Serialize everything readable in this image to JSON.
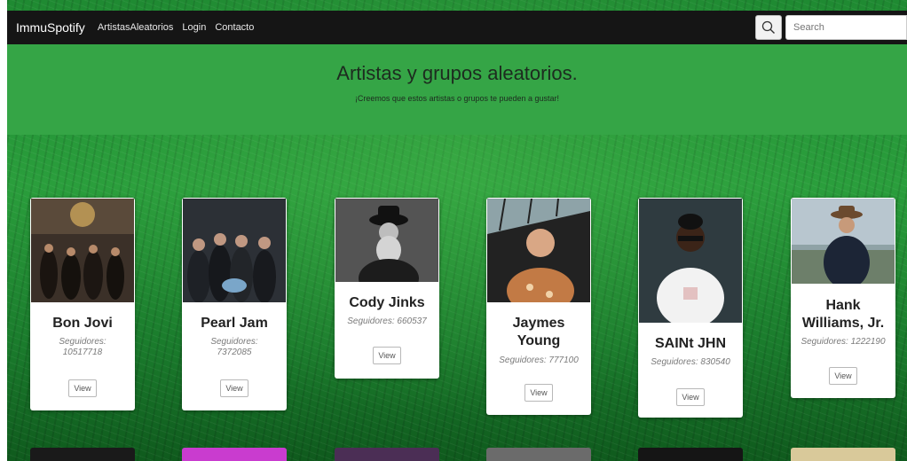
{
  "nav": {
    "brand": "ImmuSpotify",
    "links": [
      "ArtistasAleatorios",
      "Login",
      "Contacto"
    ],
    "search_placeholder": "Search",
    "search_icon": "search-icon"
  },
  "hero": {
    "title": "Artistas y grupos aleatorios.",
    "subtitle": "¡Creemos que estos artistas o grupos te pueden a gustar!"
  },
  "cards": [
    {
      "name": "Bon Jovi",
      "followers_label": "Seguidores:",
      "followers": "10517718",
      "button": "View"
    },
    {
      "name": "Pearl Jam",
      "followers_label": "Seguidores:",
      "followers": "7372085",
      "button": "View"
    },
    {
      "name": "Cody Jinks",
      "followers_text": "Seguidores: 660537",
      "button": "View"
    },
    {
      "name_line1": "Jaymes",
      "name_line2": "Young",
      "followers_text": "Seguidores: 777100",
      "button": "View"
    },
    {
      "name": "SAINt JHN",
      "followers_text": "Seguidores: 830540",
      "button": "View"
    },
    {
      "name_line1": "Hank",
      "name_line2": "Williams, Jr.",
      "followers_text": "Seguidores: 1222190",
      "button": "View"
    }
  ],
  "colors": {
    "navbar": "#151515",
    "hero": "#35a546",
    "background": "#1f8a32"
  }
}
